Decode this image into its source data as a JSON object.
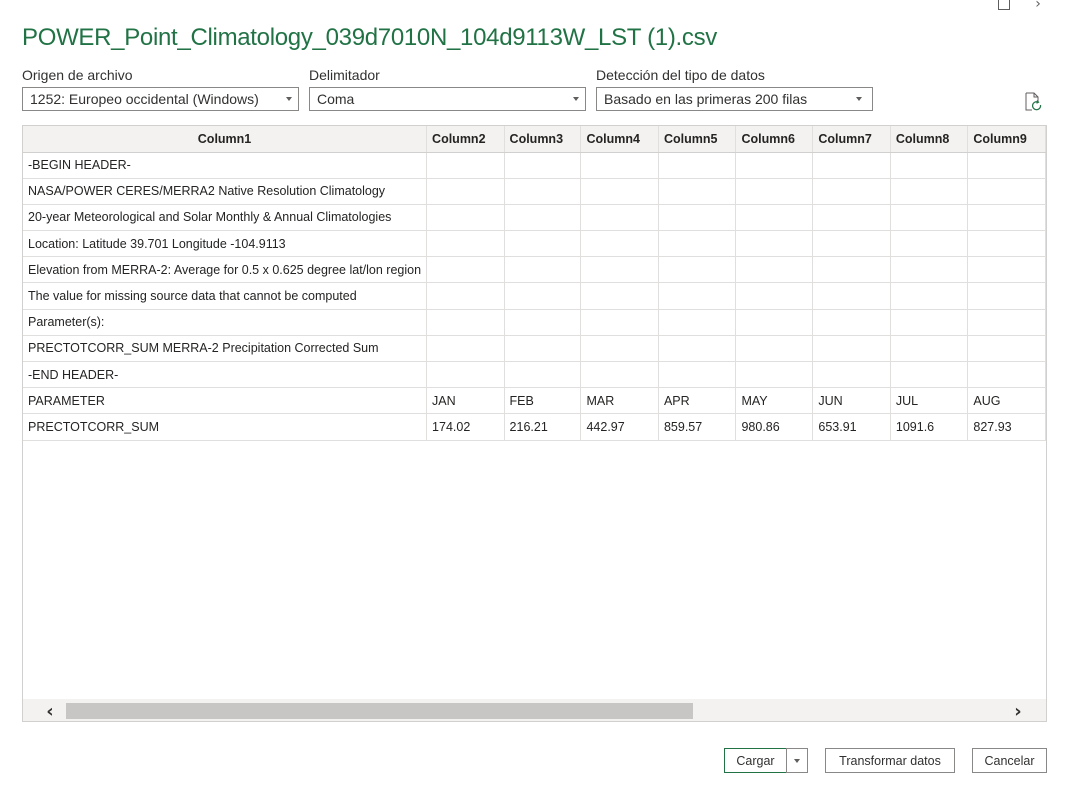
{
  "window": {
    "title": "POWER_Point_Climatology_039d7010N_104d9113W_LST (1).csv"
  },
  "options": {
    "file_origin": {
      "label": "Origen de archivo",
      "value": "1252: Europeo occidental (Windows)"
    },
    "delimiter": {
      "label": "Delimitador",
      "value": "Coma"
    },
    "type_detection": {
      "label": "Detección del tipo de datos",
      "value": "Basado en las primeras 200 filas"
    }
  },
  "table": {
    "columns": [
      "Column1",
      "Column2",
      "Column3",
      "Column4",
      "Column5",
      "Column6",
      "Column7",
      "Column8",
      "Column9"
    ],
    "rows": [
      [
        "-BEGIN HEADER-",
        "",
        "",
        "",
        "",
        "",
        "",
        "",
        ""
      ],
      [
        "NASA/POWER CERES/MERRA2 Native Resolution Climatology",
        "",
        "",
        "",
        "",
        "",
        "",
        "",
        ""
      ],
      [
        "20-year Meteorological and Solar Monthly & Annual Climatologies",
        "",
        "",
        "",
        "",
        "",
        "",
        "",
        ""
      ],
      [
        "Location: Latitude 39.701 Longitude -104.9113",
        "",
        "",
        "",
        "",
        "",
        "",
        "",
        ""
      ],
      [
        "Elevation from MERRA-2: Average for 0.5 x 0.625 degree lat/lon region",
        "",
        "",
        "",
        "",
        "",
        "",
        "",
        ""
      ],
      [
        "The value for missing source data that cannot be computed",
        "",
        "",
        "",
        "",
        "",
        "",
        "",
        ""
      ],
      [
        "Parameter(s):",
        "",
        "",
        "",
        "",
        "",
        "",
        "",
        ""
      ],
      [
        "PRECTOTCORR_SUM MERRA-2 Precipitation Corrected Sum",
        "",
        "",
        "",
        "",
        "",
        "",
        "",
        ""
      ],
      [
        "-END HEADER-",
        "",
        "",
        "",
        "",
        "",
        "",
        "",
        ""
      ],
      [
        "PARAMETER",
        "JAN",
        "FEB",
        "MAR",
        "APR",
        "MAY",
        "JUN",
        "JUL",
        "AUG"
      ],
      [
        "PRECTOTCORR_SUM",
        "174.02",
        "216.21",
        "442.97",
        "859.57",
        "980.86",
        "653.91",
        "1091.6",
        "827.93"
      ]
    ]
  },
  "scrollbar": {
    "left_arrow": "‹",
    "right_arrow": "›"
  },
  "buttons": {
    "load": "Cargar",
    "transform": "Transformar datos",
    "cancel": "Cancelar"
  }
}
